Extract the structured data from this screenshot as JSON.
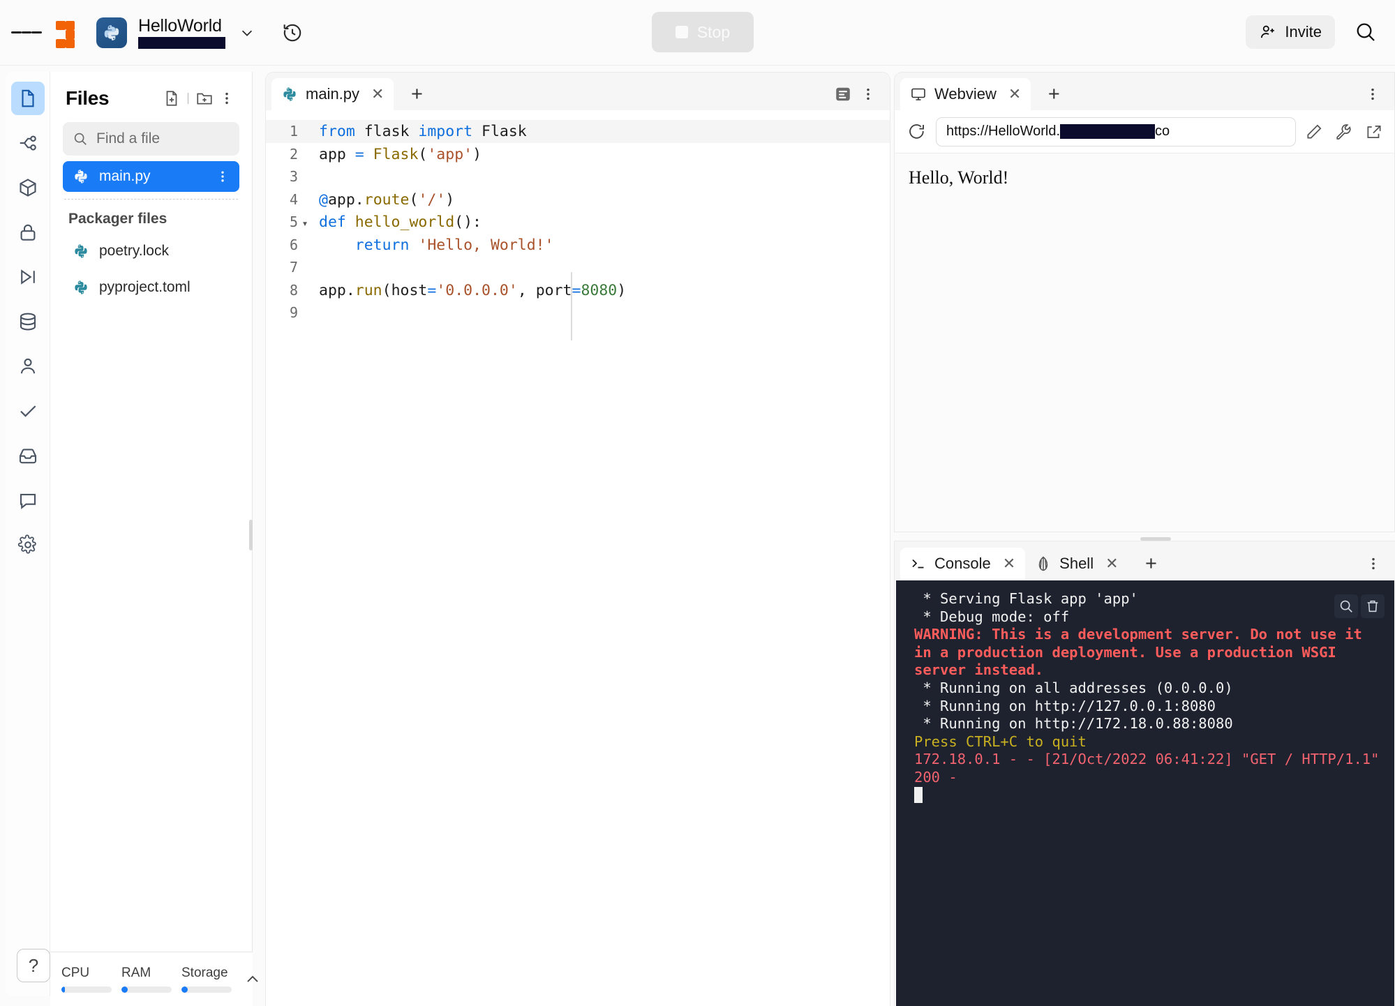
{
  "topbar": {
    "menu_icon": "hamburger-icon",
    "brand_icon": "replit-logo-icon",
    "repl_language_icon": "python-icon",
    "repl_title": "HelloWorld",
    "repl_owner": "[redacted]",
    "chevron_icon": "chevron-down-icon",
    "history_icon": "history-icon",
    "stop_label": "Stop",
    "stop_icon": "stop-square-icon",
    "invite_label": "Invite",
    "invite_icon": "add-person-icon",
    "search_icon": "search-icon"
  },
  "rail": {
    "items": [
      {
        "name": "files",
        "icon": "file-icon",
        "active": true
      },
      {
        "name": "version-control",
        "icon": "git-branch-icon",
        "active": false
      },
      {
        "name": "packages",
        "icon": "package-cube-icon",
        "active": false
      },
      {
        "name": "secrets",
        "icon": "lock-icon",
        "active": false
      },
      {
        "name": "debugger",
        "icon": "debug-step-icon",
        "active": false
      },
      {
        "name": "database",
        "icon": "database-icon",
        "active": false
      },
      {
        "name": "authentication",
        "icon": "user-icon",
        "active": false
      },
      {
        "name": "unit-tests",
        "icon": "check-icon",
        "active": false
      },
      {
        "name": "deployments",
        "icon": "inbox-tray-icon",
        "active": false
      },
      {
        "name": "chat",
        "icon": "chat-bubble-icon",
        "active": false
      },
      {
        "name": "settings",
        "icon": "gear-icon",
        "active": false
      }
    ],
    "help_label": "?"
  },
  "sidebar": {
    "title": "Files",
    "new_file_icon": "new-file-icon",
    "new_folder_icon": "new-folder-icon",
    "more_icon": "kebab-menu-icon",
    "search_placeholder": "Find a file",
    "search_icon": "search-icon",
    "search_value": "",
    "files": [
      {
        "name": "main.py",
        "icon": "python-file-icon",
        "selected": true
      }
    ],
    "group_label": "Packager files",
    "packager_files": [
      {
        "name": "poetry.lock",
        "icon": "python-file-icon"
      },
      {
        "name": "pyproject.toml",
        "icon": "python-file-icon"
      }
    ],
    "selected_file_more_icon": "kebab-menu-icon"
  },
  "statusbar": {
    "meters": [
      {
        "label": "CPU",
        "fill_percent": 7,
        "color": "#1a7bf7"
      },
      {
        "label": "RAM",
        "fill_percent": 13,
        "color": "#1a7bf7"
      },
      {
        "label": "Storage",
        "fill_percent": 12,
        "color": "#1a7bf7"
      }
    ],
    "expand_icon": "chevron-up-icon"
  },
  "editor": {
    "tabs": [
      {
        "label": "main.py",
        "icon": "python-file-icon",
        "active": true,
        "close_icon": "close-icon"
      }
    ],
    "add_tab_icon": "plus-icon",
    "format_icon": "format-document-icon",
    "more_icon": "kebab-menu-icon",
    "lines": [
      {
        "no": "1",
        "fold": "",
        "highlight": true,
        "tokens": [
          {
            "t": "from ",
            "c": "k"
          },
          {
            "t": "flask ",
            "c": ""
          },
          {
            "t": "import ",
            "c": "k"
          },
          {
            "t": "Flask",
            "c": ""
          }
        ]
      },
      {
        "no": "2",
        "fold": "",
        "highlight": false,
        "tokens": [
          {
            "t": "app ",
            "c": ""
          },
          {
            "t": "= ",
            "c": "op"
          },
          {
            "t": "Flask",
            "c": "fn"
          },
          {
            "t": "(",
            "c": ""
          },
          {
            "t": "'app'",
            "c": "st"
          },
          {
            "t": ")",
            "c": ""
          }
        ]
      },
      {
        "no": "3",
        "fold": "",
        "highlight": false,
        "tokens": [
          {
            "t": "",
            "c": ""
          }
        ]
      },
      {
        "no": "4",
        "fold": "",
        "highlight": false,
        "tokens": [
          {
            "t": "@",
            "c": "op"
          },
          {
            "t": "app",
            "c": ""
          },
          {
            "t": ".",
            "c": ""
          },
          {
            "t": "route",
            "c": "fn"
          },
          {
            "t": "(",
            "c": ""
          },
          {
            "t": "'/'",
            "c": "st"
          },
          {
            "t": ")",
            "c": ""
          }
        ]
      },
      {
        "no": "5",
        "fold": "▾",
        "highlight": false,
        "tokens": [
          {
            "t": "def ",
            "c": "k"
          },
          {
            "t": "hello_world",
            "c": "fn"
          },
          {
            "t": "():",
            "c": ""
          }
        ]
      },
      {
        "no": "6",
        "fold": "",
        "highlight": false,
        "tokens": [
          {
            "t": "    ",
            "c": ""
          },
          {
            "t": "return ",
            "c": "k"
          },
          {
            "t": "'Hello, World!'",
            "c": "st"
          }
        ]
      },
      {
        "no": "7",
        "fold": "",
        "highlight": false,
        "tokens": [
          {
            "t": "",
            "c": ""
          }
        ]
      },
      {
        "no": "8",
        "fold": "",
        "highlight": false,
        "tokens": [
          {
            "t": "app",
            "c": ""
          },
          {
            "t": ".",
            "c": ""
          },
          {
            "t": "run",
            "c": "fn"
          },
          {
            "t": "(host",
            "c": ""
          },
          {
            "t": "=",
            "c": "op"
          },
          {
            "t": "'0.0.0.0'",
            "c": "st"
          },
          {
            "t": ", port",
            "c": ""
          },
          {
            "t": "=",
            "c": "op"
          },
          {
            "t": "8080",
            "c": "nu"
          },
          {
            "t": ")",
            "c": ""
          }
        ]
      },
      {
        "no": "9",
        "fold": "",
        "highlight": false,
        "tokens": [
          {
            "t": "",
            "c": ""
          }
        ]
      }
    ]
  },
  "webview": {
    "tabs": [
      {
        "label": "Webview",
        "icon": "monitor-icon",
        "active": true,
        "close_icon": "close-icon"
      }
    ],
    "add_tab_icon": "plus-icon",
    "more_icon": "kebab-menu-icon",
    "reload_icon": "reload-icon",
    "url_prefix": "https://HelloWorld.",
    "url_redacted": "[redacted]",
    "url_suffix": "co",
    "edit_icon": "pencil-icon",
    "devtools_icon": "wrench-icon",
    "open_external_icon": "external-link-icon",
    "page_text": "Hello, World!"
  },
  "console": {
    "tabs": [
      {
        "label": "Console",
        "icon": "prompt-icon",
        "active": true,
        "close_icon": "close-icon"
      },
      {
        "label": "Shell",
        "icon": "shell-icon",
        "active": false,
        "close_icon": "close-icon"
      }
    ],
    "add_tab_icon": "plus-icon",
    "more_icon": "kebab-menu-icon",
    "search_icon": "search-icon",
    "clear_icon": "trash-icon",
    "background_color": "#1d222e",
    "lines": [
      {
        "text": " * Serving Flask app 'app'",
        "class": ""
      },
      {
        "text": " * Debug mode: off",
        "class": ""
      },
      {
        "text": "WARNING: This is a development server. Do not use it in a production deployment. Use a production WSGI server instead.",
        "class": "c-red"
      },
      {
        "text": " * Running on all addresses (0.0.0.0)",
        "class": ""
      },
      {
        "text": " * Running on http://127.0.0.1:8080",
        "class": ""
      },
      {
        "text": " * Running on http://172.18.0.88:8080",
        "class": ""
      },
      {
        "text": "Press CTRL+C to quit",
        "class": "c-yellow"
      },
      {
        "text": "172.18.0.1 - - [21/Oct/2022 06:41:22] \"GET / HTTP/1.1\" 200 -",
        "class": "c-pink"
      }
    ]
  }
}
